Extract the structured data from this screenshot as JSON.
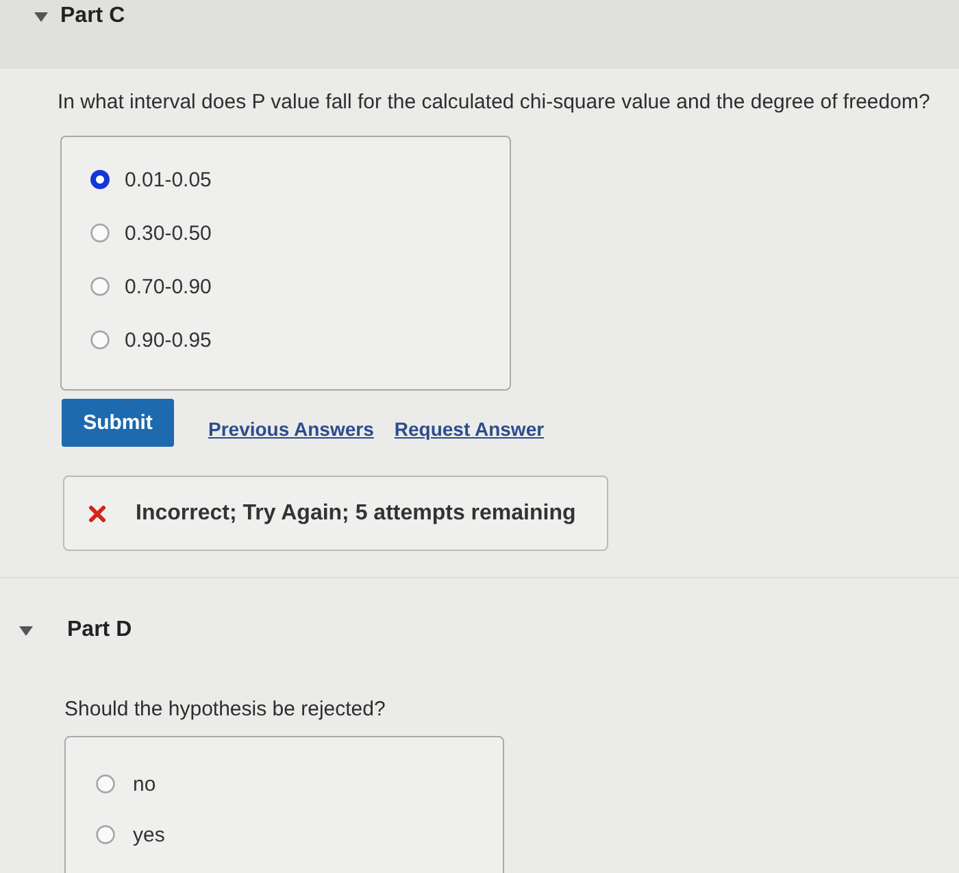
{
  "parts": [
    {
      "title": "Part C",
      "expanded": true,
      "question": "In what interval does P value fall for the calculated chi-square value and the degree of freedom?",
      "options": [
        {
          "label": "0.01-0.05",
          "selected": true
        },
        {
          "label": "0.30-0.50",
          "selected": false
        },
        {
          "label": "0.70-0.90",
          "selected": false
        },
        {
          "label": "0.90-0.95",
          "selected": false
        }
      ],
      "submit": "Submit",
      "links": [
        "Previous Answers",
        "Request Answer"
      ],
      "feedback": {
        "kind": "incorrect",
        "text": "Incorrect; Try Again; 5 attempts remaining"
      }
    },
    {
      "title": "Part D",
      "expanded": true,
      "question": "Should the hypothesis be rejected?",
      "options": [
        {
          "label": "no",
          "selected": false
        },
        {
          "label": "yes",
          "selected": false
        }
      ]
    }
  ]
}
